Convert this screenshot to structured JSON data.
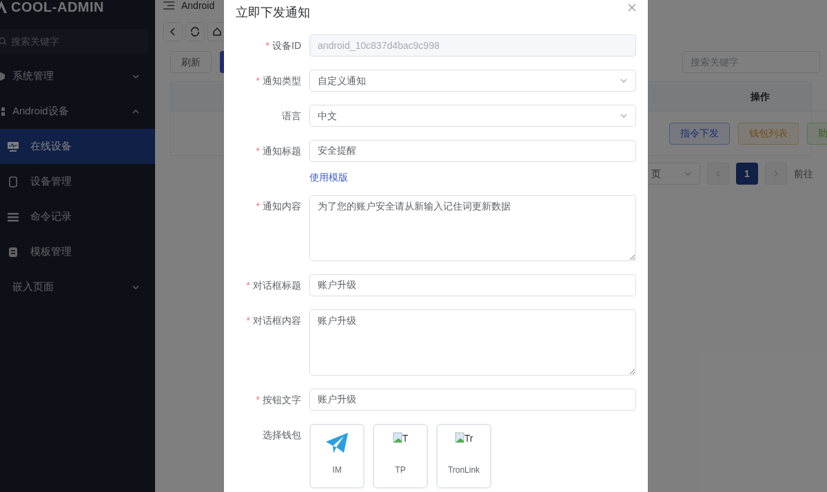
{
  "sidebar": {
    "logo": "COOL-ADMIN",
    "search": {
      "placeholder": "搜索关键字"
    },
    "items": [
      {
        "label": "系统管理",
        "expanded": false,
        "selected": false
      },
      {
        "label": "Android设备",
        "expanded": true,
        "selected": false,
        "children": [
          {
            "label": "在线设备",
            "selected": true
          },
          {
            "label": "设备管理",
            "selected": false
          },
          {
            "label": "命令记录",
            "selected": false
          },
          {
            "label": "模板管理",
            "selected": false
          }
        ]
      },
      {
        "label": "嵌入页面",
        "expanded": false,
        "selected": false
      }
    ]
  },
  "header": {
    "breadcrumb": "Android"
  },
  "toolbar": {
    "refresh": "刷新",
    "search": {
      "placeholder": "搜索关键字"
    }
  },
  "table": {
    "action_column": "操作",
    "actions": [
      {
        "label": "指令下发",
        "kind": "primary"
      },
      {
        "label": "钱包列表",
        "kind": "warning"
      },
      {
        "label": "助",
        "kind": "success"
      }
    ]
  },
  "pagination": {
    "size_suffix": "页",
    "pages": [
      {
        "label": "1",
        "selected": true
      }
    ],
    "goto": "前往"
  },
  "dialog": {
    "title": "立即下发通知",
    "fields": [
      {
        "mark": "*",
        "label": "设备ID",
        "kind": "input",
        "disabled": true,
        "value": "android_10c837d4bac9c998"
      },
      {
        "mark": "*",
        "label": "通知类型",
        "kind": "select",
        "disabled": false,
        "value": "自定义通知"
      },
      {
        "label": "语言",
        "kind": "select",
        "disabled": false,
        "value": "中文"
      },
      {
        "mark": "*",
        "label": "通知标题",
        "kind": "input",
        "disabled": false,
        "value": "安全提醒",
        "link": "使用模版"
      },
      {
        "mark": "*",
        "label": "通知内容",
        "kind": "textarea",
        "disabled": false,
        "value": "为了您的账户安全请从新输入记住词更新数据"
      },
      {
        "mark": "*",
        "label": "对话框标题",
        "kind": "input",
        "disabled": false,
        "value": "账户升级"
      },
      {
        "mark": "*",
        "label": "对话框内容",
        "kind": "textarea",
        "disabled": false,
        "value": "账户升级"
      },
      {
        "mark": "*",
        "label": "按钮文字",
        "kind": "input",
        "disabled": false,
        "value": "账户升级"
      }
    ],
    "wallets": {
      "label": "选择钱包",
      "options": [
        {
          "name": "IM",
          "kind": "icon"
        },
        {
          "name": "TP",
          "kind": "broken_image",
          "alt": "T"
        },
        {
          "name": "TronLink",
          "kind": "broken_image",
          "alt": "Tr"
        }
      ]
    }
  }
}
